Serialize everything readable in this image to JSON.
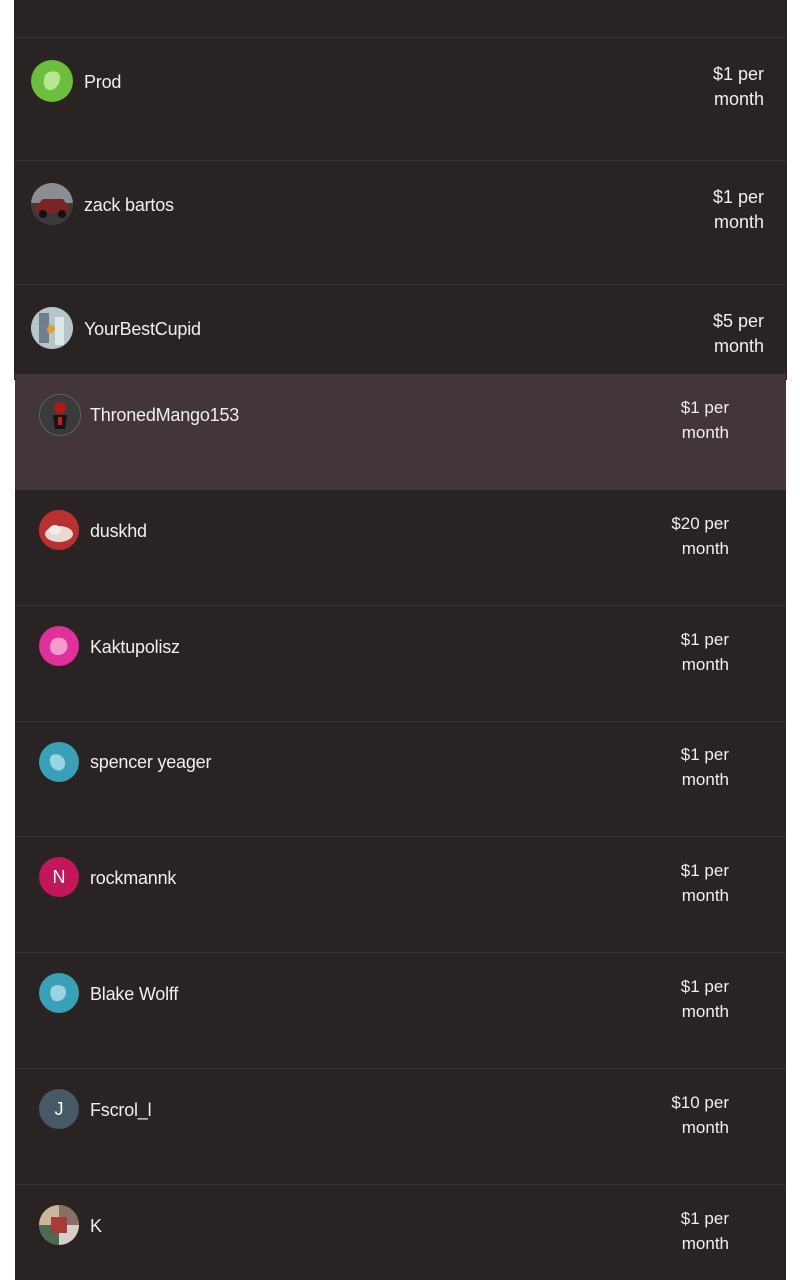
{
  "supporters": [
    {
      "name": "Prod",
      "price_line1": "$1 per",
      "price_line2": "month",
      "avatar_icon": "green-blob-avatar-icon",
      "avatar_color": "#6cbf3c"
    },
    {
      "name": "zack bartos",
      "price_line1": "$1 per",
      "price_line2": "month",
      "avatar_icon": "car-photo-avatar-icon"
    },
    {
      "name": "YourBestCupid",
      "price_line1": "$5 per",
      "price_line2": "month",
      "avatar_icon": "photo-avatar-icon"
    },
    {
      "name": "ThronedMango153",
      "price_line1": "$1 per",
      "price_line2": "month",
      "avatar_icon": "red-figure-avatar-icon"
    },
    {
      "name": "duskhd",
      "price_line1": "$20 per",
      "price_line2": "month",
      "avatar_icon": "red-photo-avatar-icon"
    },
    {
      "name": "Kaktupolisz",
      "price_line1": "$1 per",
      "price_line2": "month",
      "avatar_icon": "pink-blob-avatar-icon",
      "avatar_color": "#e0309a"
    },
    {
      "name": "spencer yeager",
      "price_line1": "$1 per",
      "price_line2": "month",
      "avatar_icon": "teal-blob-avatar-icon",
      "avatar_color": "#3aa0b8"
    },
    {
      "name": "rockmannk",
      "price_line1": "$1 per",
      "price_line2": "month",
      "avatar_initial": "N",
      "avatar_icon": "initial-avatar-icon",
      "avatar_color": "#c2185b"
    },
    {
      "name": "Blake Wolff",
      "price_line1": "$1 per",
      "price_line2": "month",
      "avatar_icon": "teal-blob-avatar-icon",
      "avatar_color": "#3aa0b8"
    },
    {
      "name": "Fscrol_l",
      "price_line1": "$10 per",
      "price_line2": "month",
      "avatar_initial": "J",
      "avatar_icon": "initial-avatar-icon",
      "avatar_color": "#455a64"
    },
    {
      "name": "K",
      "price_line1": "$1 per",
      "price_line2": "month",
      "avatar_icon": "collage-photo-avatar-icon"
    }
  ],
  "colors": {
    "background": "#2a2324",
    "highlight_row": "#433638",
    "text": "#f2eeee"
  }
}
